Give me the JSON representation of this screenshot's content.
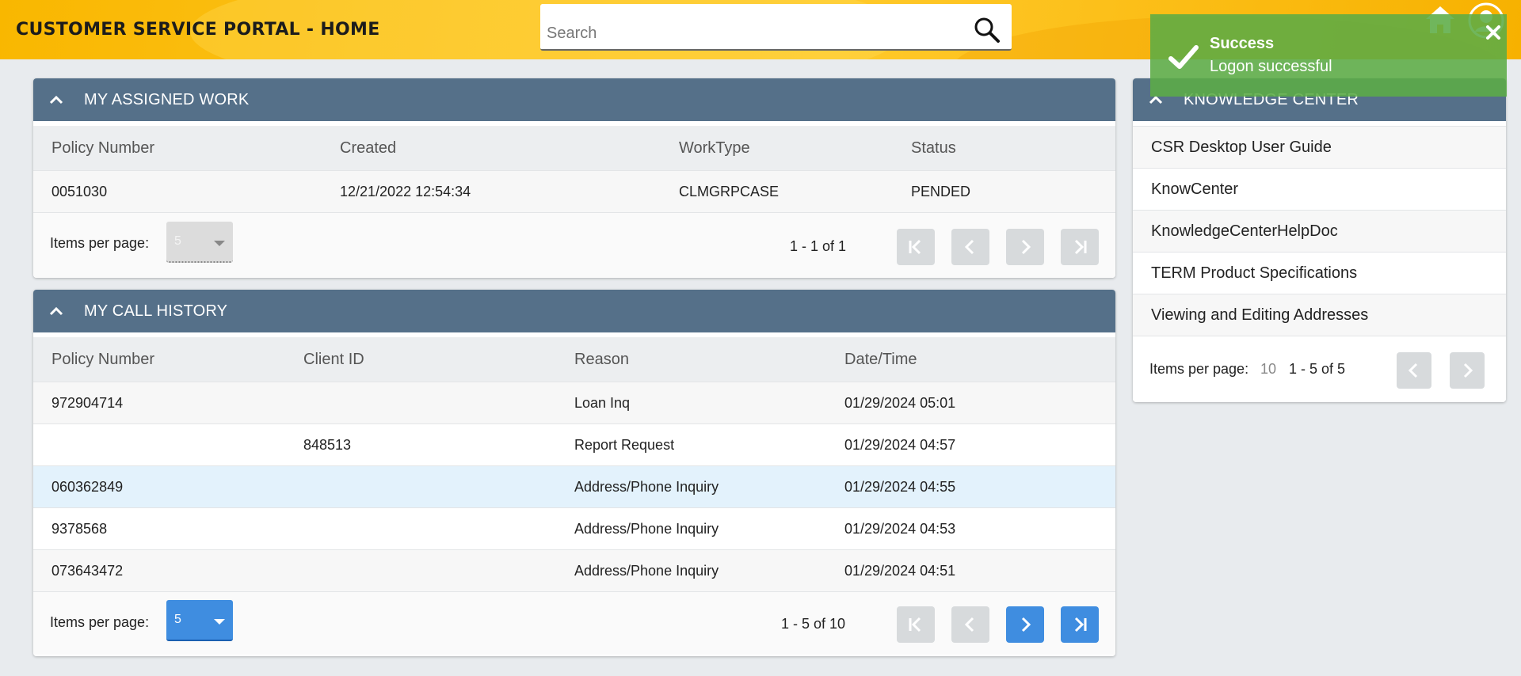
{
  "header": {
    "title": "CUSTOMER SERVICE PORTAL - HOME",
    "search_placeholder": "Search"
  },
  "assigned_work": {
    "title": "MY ASSIGNED WORK",
    "columns": [
      "Policy Number",
      "Created",
      "WorkType",
      "Status"
    ],
    "rows": [
      [
        "0051030",
        "12/21/2022 12:54:34",
        "CLMGRPCASE",
        "PENDED"
      ]
    ],
    "items_per_page_label": "Items per page:",
    "items_per_page_value": "5",
    "range": "1 - 1 of 1"
  },
  "call_history": {
    "title": "MY CALL HISTORY",
    "columns": [
      "Policy Number",
      "Client ID",
      "Reason",
      "Date/Time"
    ],
    "rows": [
      [
        "972904714",
        "",
        "Loan Inq",
        "01/29/2024 05:01"
      ],
      [
        "",
        "848513",
        "Report Request",
        "01/29/2024 04:57"
      ],
      [
        "060362849",
        "",
        "Address/Phone Inquiry",
        "01/29/2024 04:55"
      ],
      [
        "9378568",
        "",
        "Address/Phone Inquiry",
        "01/29/2024 04:53"
      ],
      [
        "073643472",
        "",
        "Address/Phone Inquiry",
        "01/29/2024 04:51"
      ]
    ],
    "items_per_page_label": "Items per page:",
    "items_per_page_value": "5",
    "range": "1 - 5 of 10"
  },
  "knowledge_center": {
    "title": "KNOWLEDGE CENTER",
    "items": [
      "CSR Desktop User Guide",
      "KnowCenter",
      "KnowledgeCenterHelpDoc",
      "TERM Product Specifications",
      "Viewing and Editing Addresses"
    ],
    "items_per_page_label": "Items per page:",
    "items_per_page_value": "10",
    "range": "1 - 5 of 5"
  },
  "toast": {
    "title": "Success",
    "message": "Logon successful"
  },
  "colors": {
    "panel_header": "#557089",
    "accent_button": "#3f8de0",
    "toast_green": "#5cac46",
    "header_yellow": "#fcc21c"
  },
  "icons": {
    "search": "search-icon",
    "home": "home-icon",
    "user": "user-icon",
    "collapse": "chevron-up-icon",
    "first": "first-page-icon",
    "prev": "prev-page-icon",
    "next": "next-page-icon",
    "last": "last-page-icon",
    "check": "check-icon",
    "close": "close-icon"
  }
}
